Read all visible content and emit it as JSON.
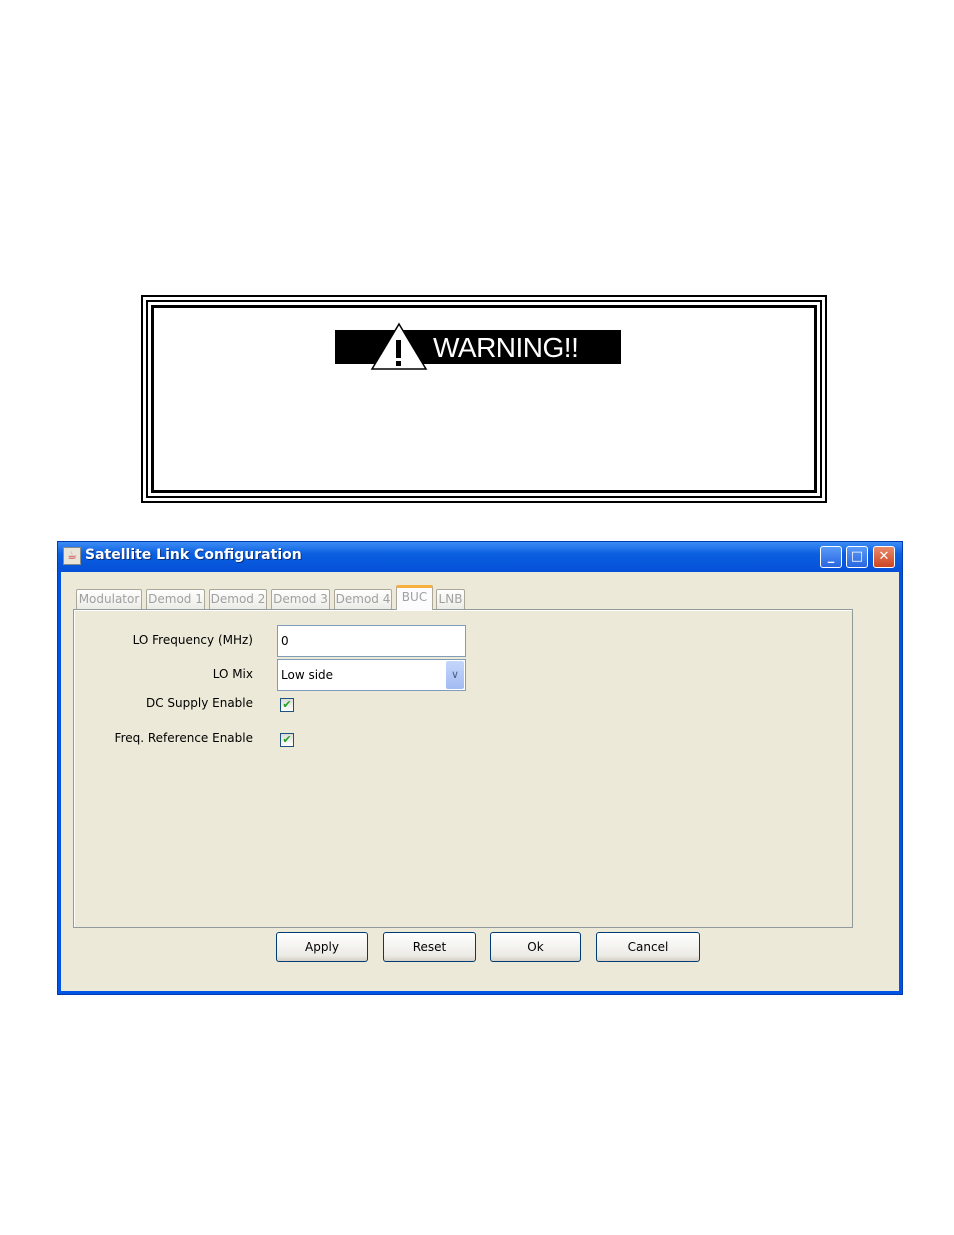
{
  "warning": {
    "label": "WARNING!!",
    "symbol": "!"
  },
  "window": {
    "title": "Satellite Link Configuration",
    "controls": {
      "minimize": "minimize-icon",
      "maximize": "maximize-icon",
      "close": "close-icon"
    },
    "tabs": [
      {
        "label": "Modulator",
        "selected": false
      },
      {
        "label": "Demod 1",
        "selected": false
      },
      {
        "label": "Demod 2",
        "selected": false
      },
      {
        "label": "Demod 3",
        "selected": false
      },
      {
        "label": "Demod 4",
        "selected": false
      },
      {
        "label": "BUC",
        "selected": true
      },
      {
        "label": "LNB",
        "selected": false
      }
    ],
    "form": {
      "lo_frequency": {
        "label": "LO Frequency (MHz)",
        "value": "0"
      },
      "lo_mix": {
        "label": "LO Mix",
        "value": "Low side"
      },
      "dc_supply": {
        "label": "DC Supply Enable",
        "checked": true
      },
      "freq_ref": {
        "label": "Freq. Reference Enable",
        "checked": true
      }
    },
    "buttons": {
      "apply": "Apply",
      "reset": "Reset",
      "ok": "Ok",
      "cancel": "Cancel"
    }
  }
}
